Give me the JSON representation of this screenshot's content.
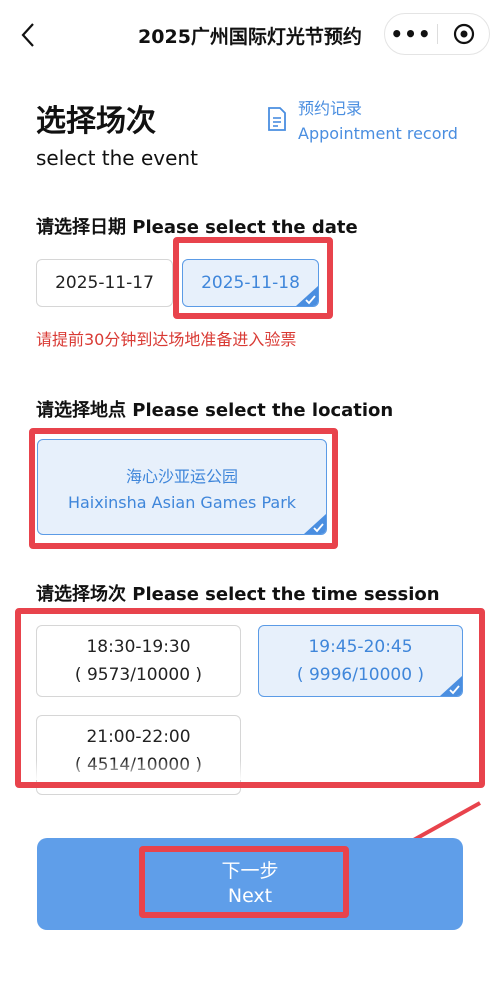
{
  "header": {
    "title": "2025广州国际灯光节预约",
    "more_icon": "•••"
  },
  "heading": {
    "title_cn": "选择场次",
    "title_en": "select the event",
    "record_cn": "预约记录",
    "record_en": "Appointment record"
  },
  "date_section": {
    "label": "请选择日期  Please select the date",
    "options": [
      "2025-11-17",
      "2025-11-18"
    ],
    "selected": "2025-11-18",
    "notice": "请提前30分钟到达场地准备进入验票"
  },
  "location_section": {
    "label": "请选择地点  Please select the location",
    "option_cn": "海心沙亚运公园",
    "option_en": "Haixinsha Asian Games Park"
  },
  "session_section": {
    "label": "请选择场次  Please select the time session",
    "sessions": [
      {
        "time": "18:30-19:30",
        "count": "( 9573/10000 )"
      },
      {
        "time": "19:45-20:45",
        "count": "( 9996/10000 )"
      },
      {
        "time": "21:00-22:00",
        "count": "( 4514/10000 )"
      }
    ],
    "selected_index": 1
  },
  "next_button": {
    "label_cn": "下一步",
    "label_en": "Next"
  },
  "colors": {
    "accent": "#4a8ee0",
    "selected_bg": "#e7f0fb",
    "button": "#5f9ee9",
    "warning": "#d93a34",
    "highlight": "#e8434c"
  }
}
